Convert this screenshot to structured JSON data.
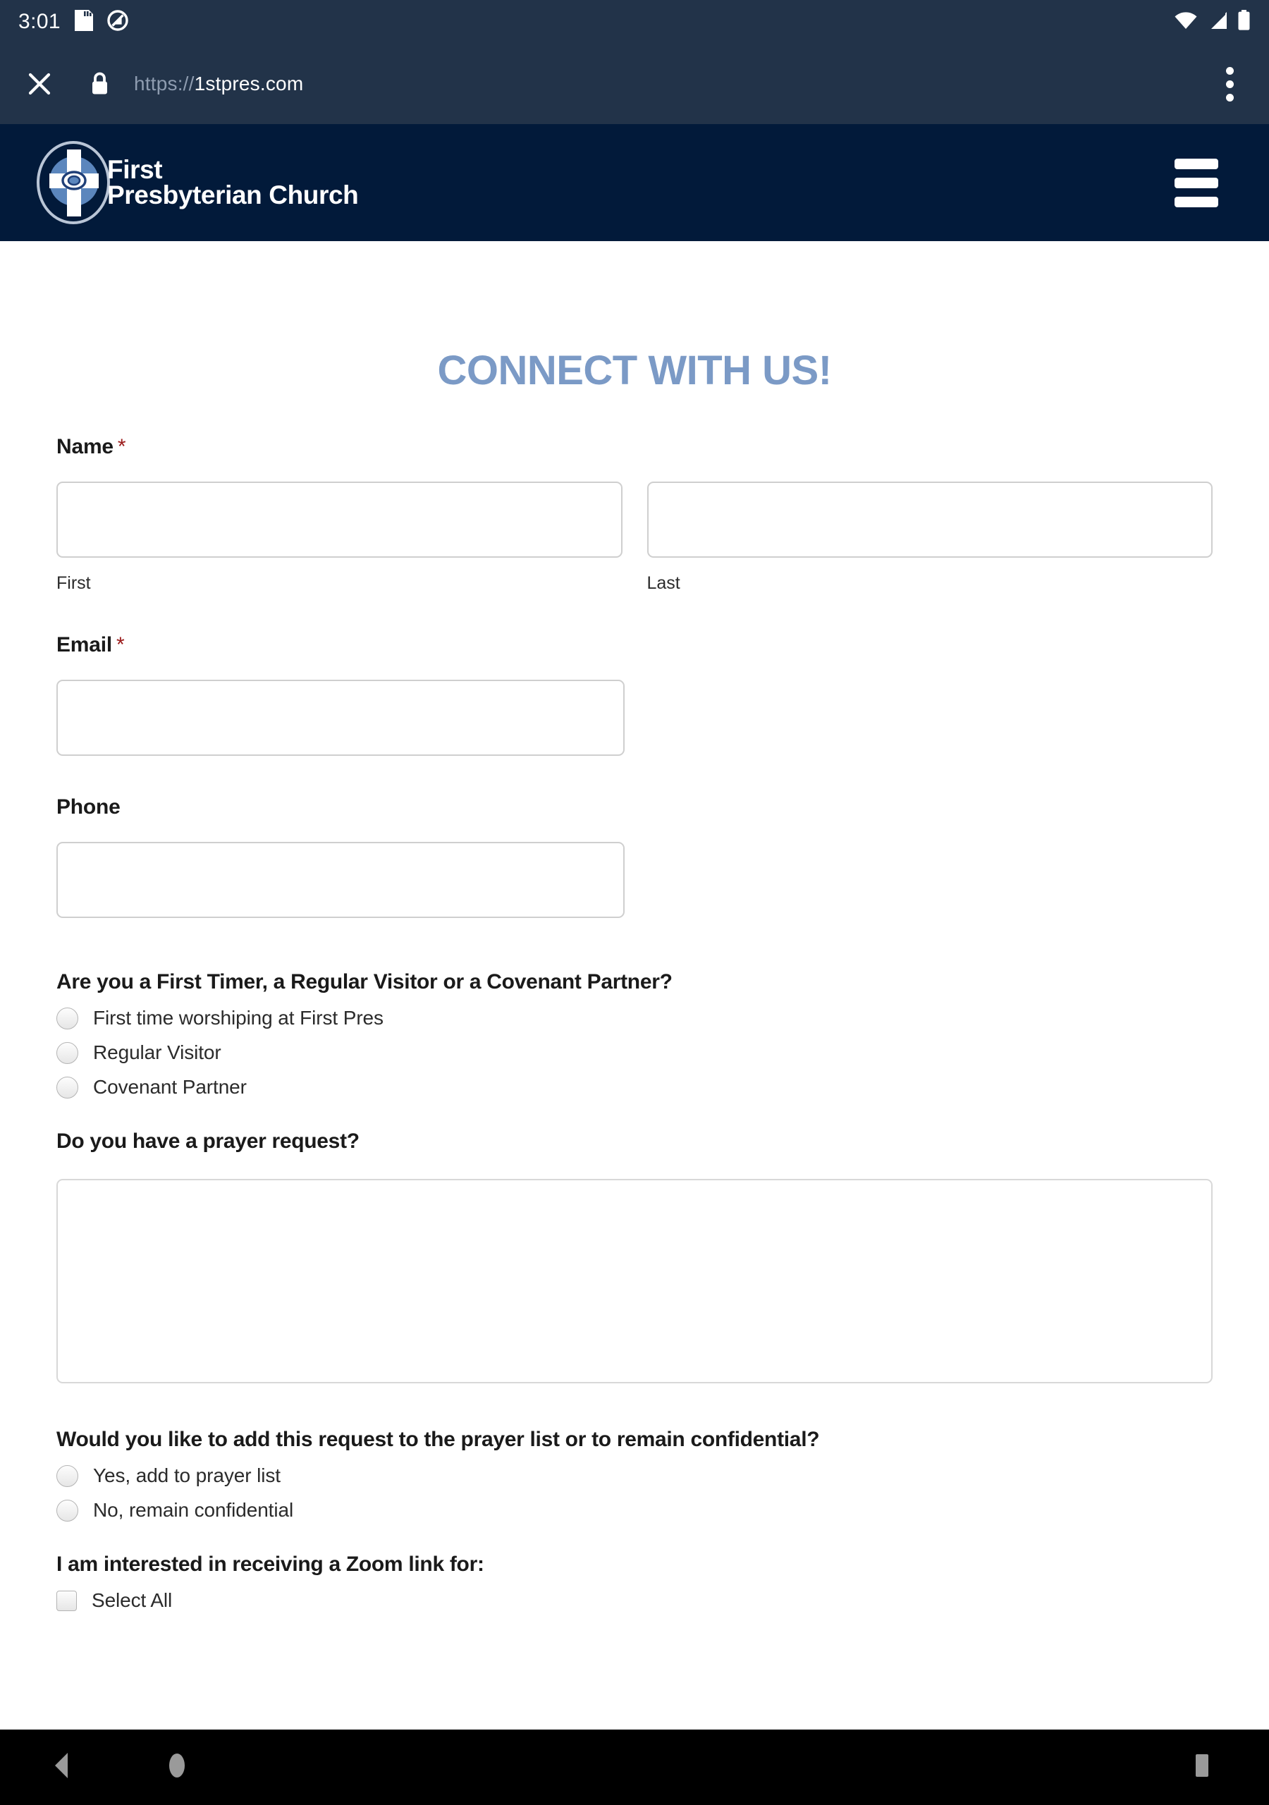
{
  "statusbar": {
    "clock": "3:01",
    "icons": [
      "sd-card-icon",
      "do-not-disturb-icon",
      "wifi-icon",
      "cell-signal-icon",
      "battery-icon"
    ]
  },
  "browser": {
    "close_label": "close-icon",
    "lock_label": "lock-icon",
    "url_scheme": "https://",
    "url_host": "1stpres.com",
    "menu_label": "overflow-menu-icon"
  },
  "site_header": {
    "logo_line1": "First",
    "logo_line2": "Presbyterian Church",
    "menu_label": "hamburger-menu-icon",
    "bg_color": "#021a3a"
  },
  "page": {
    "title": "CONNECT WITH US!",
    "title_color": "#7b9ac6",
    "required_marker": "*"
  },
  "form": {
    "name": {
      "label": "Name",
      "required": true,
      "first_value": "",
      "first_sub_label": "First",
      "last_value": "",
      "last_sub_label": "Last"
    },
    "email": {
      "label": "Email",
      "required": true,
      "value": ""
    },
    "phone": {
      "label": "Phone",
      "required": false,
      "value": ""
    },
    "visitor_type": {
      "label": "Are you a First Timer, a Regular Visitor or a Covenant Partner?",
      "options": [
        {
          "label": "First time worshiping at First Pres",
          "selected": false
        },
        {
          "label": "Regular Visitor",
          "selected": false
        },
        {
          "label": "Covenant Partner",
          "selected": false
        }
      ]
    },
    "prayer_request": {
      "label": "Do you have a prayer request?",
      "value": ""
    },
    "prayer_visibility": {
      "label": "Would you like to add this request to the prayer list or to remain confidential?",
      "options": [
        {
          "label": "Yes, add to prayer list",
          "selected": false
        },
        {
          "label": "No, remain confidential",
          "selected": false
        }
      ]
    },
    "zoom_link": {
      "label": "I am interested in receiving a Zoom link for:",
      "options": [
        {
          "label": "Select All",
          "selected": false
        }
      ]
    }
  },
  "navbar": {
    "back_label": "back-icon",
    "home_label": "home-icon",
    "recents_label": "recents-icon"
  }
}
